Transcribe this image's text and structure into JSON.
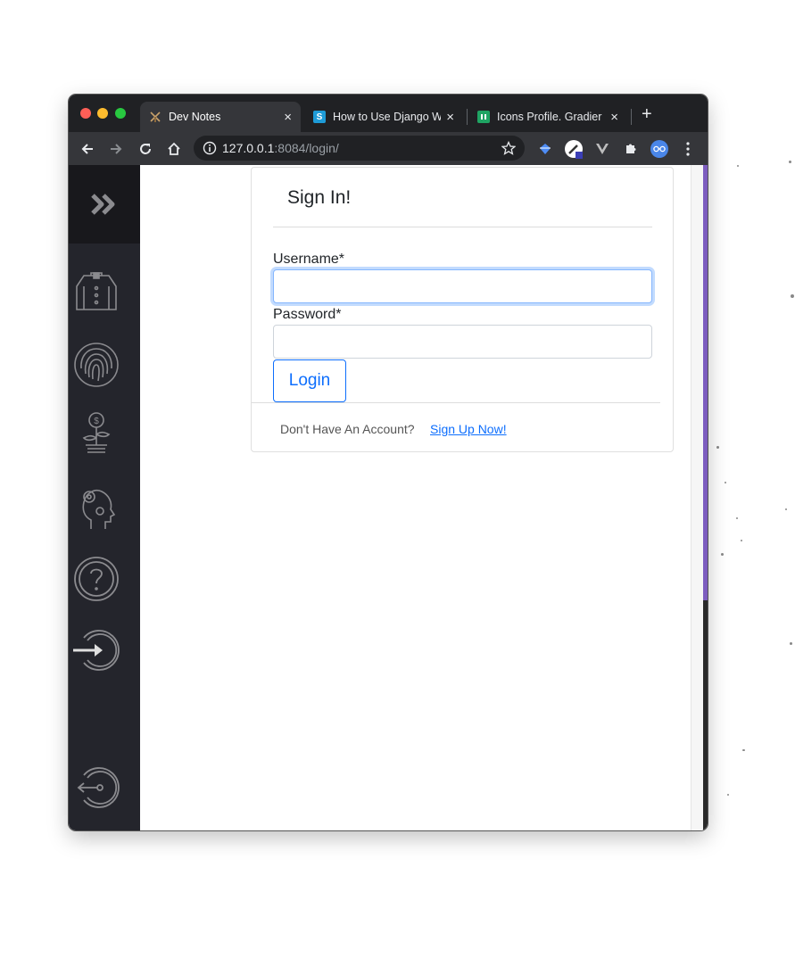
{
  "browser": {
    "tabs": [
      {
        "title": "Dev Notes",
        "active": true
      },
      {
        "title": "How to Use Django W",
        "favicon_letter": "S"
      },
      {
        "title": "Icons Profile. Gradier"
      }
    ],
    "close_glyph": "×",
    "new_tab_glyph": "+",
    "address": {
      "host": "127.0.0.1",
      "rest": ":8084/login/"
    }
  },
  "sidebar": {
    "icons": [
      "double-chevron-icon",
      "shirt-icon",
      "fingerprint-icon",
      "money-plant-icon",
      "mind-gear-icon",
      "question-icon",
      "login-arrow-icon",
      "logout-icon"
    ]
  },
  "form": {
    "title": "Sign In!",
    "username_label": "Username*",
    "username_value": "",
    "password_label": "Password*",
    "password_value": "",
    "login_label": "Login",
    "footer_text": "Don't Have An Account?",
    "signup_link": "Sign Up Now!"
  },
  "colors": {
    "accent": "#0d6efd",
    "sidebar_bg": "#24252c",
    "chrome_dark": "#202124",
    "purple_bar": "#7d5dbf"
  }
}
